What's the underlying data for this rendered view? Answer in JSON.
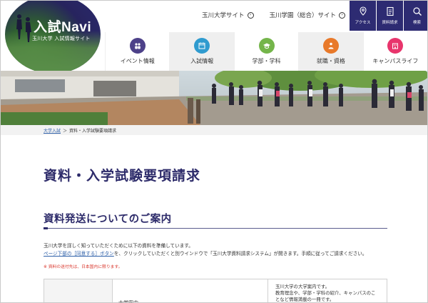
{
  "logo": {
    "title": "入試Navi",
    "subtitle": "玉川大学 入試情報サイト"
  },
  "top_links": [
    {
      "label": "玉川大学サイト"
    },
    {
      "label": "玉川学園（総合）サイト"
    }
  ],
  "utility": [
    {
      "label": "アクセス",
      "icon": "map-pin-icon"
    },
    {
      "label": "資料請求",
      "icon": "document-icon"
    },
    {
      "label": "検索",
      "icon": "search-icon"
    }
  ],
  "nav": [
    {
      "label": "イベント情報",
      "icon": "people-icon",
      "color": "#4d4189"
    },
    {
      "label": "入試情報",
      "icon": "calendar-icon",
      "color": "#2f9bcf"
    },
    {
      "label": "学部・学科",
      "icon": "graduation-cap-icon",
      "color": "#74b54a"
    },
    {
      "label": "就職・資格",
      "icon": "career-icon",
      "color": "#e8792a"
    },
    {
      "label": "キャンパスライフ",
      "icon": "building-icon",
      "color": "#e8356c"
    }
  ],
  "breadcrumb": {
    "home": "大学入試",
    "separator": "＞",
    "current": "資料・入学試験要項請求"
  },
  "page_title": "資料・入学試験要項請求",
  "section_title": "資料発送についてのご案内",
  "body": {
    "line1": "玉川大学を詳しく知っていただくために以下の資料を準備しています。",
    "link": "ページ下部の［同意する］ボタン",
    "line2_rest": "を、クリックしていただくと別ウインドウで「玉川大学資料請求システム」が開きます。手順に従ってご請求ください。"
  },
  "note": "※ 資料の送付先は、日本国内に限ります。",
  "table": {
    "row1_item": "大学案内",
    "row1_desc_1": "玉川大学の大学案内です。",
    "row1_desc_2": "教育理念や、学部・学科の紹介、キャンパスのこ",
    "row1_desc_3": "となど情報満載の一冊です。"
  },
  "colors": {
    "brand_navy": "#2d2b72",
    "link_blue": "#2d5fa8",
    "note_red": "#d9352b"
  }
}
